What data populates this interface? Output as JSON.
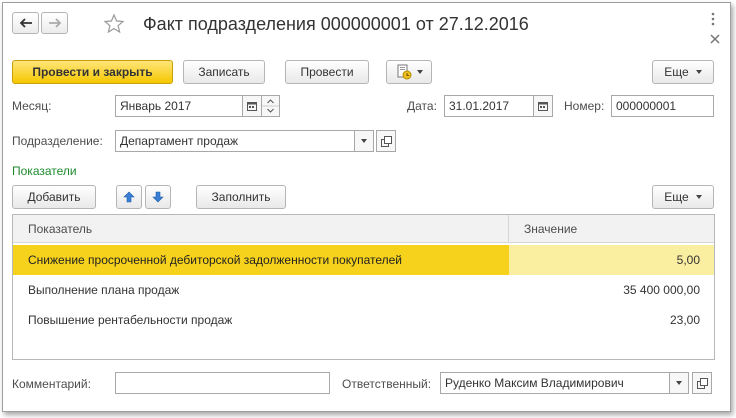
{
  "window": {
    "title": "Факт подразделения 000000001 от 27.12.2016",
    "menu_icon": "more-vertical-icon",
    "close_icon": "close-icon"
  },
  "toolbar": {
    "post_and_close": "Провести и закрыть",
    "save": "Записать",
    "post": "Провести",
    "more": "Еще"
  },
  "form": {
    "month_label": "Месяц:",
    "month_value": "Январь 2017",
    "date_label": "Дата:",
    "date_value": "31.01.2017",
    "number_label": "Номер:",
    "number_value": "000000001",
    "department_label": "Подразделение:",
    "department_value": "Департамент продаж"
  },
  "indicators": {
    "section_label": "Показатели",
    "add": "Добавить",
    "fill": "Заполнить",
    "more": "Еще",
    "columns": [
      "Показатель",
      "Значение"
    ],
    "rows": [
      {
        "name": "Снижение просроченной дебиторской задолженности покупателей",
        "value": "5,00",
        "selected": true
      },
      {
        "name": "Выполнение плана продаж",
        "value": "35 400 000,00",
        "selected": false
      },
      {
        "name": "Повышение рентабельности продаж",
        "value": "23,00",
        "selected": false
      }
    ]
  },
  "footer": {
    "comment_label": "Комментарий:",
    "comment_value": "",
    "responsible_label": "Ответственный:",
    "responsible_value": "Руденко Максим Владимирович"
  },
  "colors": {
    "primary_button": "#f5c800",
    "selected_row": "#f7d21c",
    "section_label": "#1d8a2e"
  }
}
